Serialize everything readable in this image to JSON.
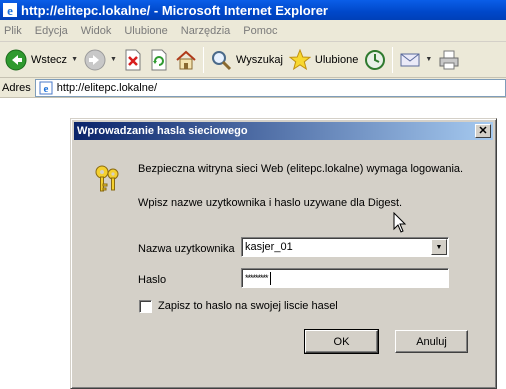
{
  "window": {
    "title": "http://elitepc.lokalne/ - Microsoft Internet Explorer"
  },
  "menu": {
    "items": [
      "Plik",
      "Edycja",
      "Widok",
      "Ulubione",
      "Narzędzia",
      "Pomoc"
    ]
  },
  "toolbar": {
    "back_label": "Wstecz",
    "search_label": "Wyszukaj",
    "favorites_label": "Ulubione"
  },
  "address": {
    "label": "Adres",
    "url": "http://elitepc.lokalne/"
  },
  "dialog": {
    "title": "Wprowadzanie hasla sieciowego",
    "close_glyph": "✕",
    "message": "Bezpieczna witryna sieci Web (elitepc.lokalne) wymaga logowania.",
    "instruction": "Wpisz nazwe uzytkownika i haslo uzywane dla Digest.",
    "username_label": "Nazwa uzytkownika",
    "username_value": "kasjer_01",
    "password_label": "Haslo",
    "password_value": "*********",
    "save_password_label": "Zapisz to haslo na swojej liscie hasel",
    "save_password_checked": false,
    "ok_label": "OK",
    "cancel_label": "Anuluj"
  },
  "colors": {
    "title_blue": "#0047c9",
    "dialog_title_start": "#0a246a",
    "dialog_title_end": "#a6caf0",
    "face": "#d4d0c8"
  }
}
